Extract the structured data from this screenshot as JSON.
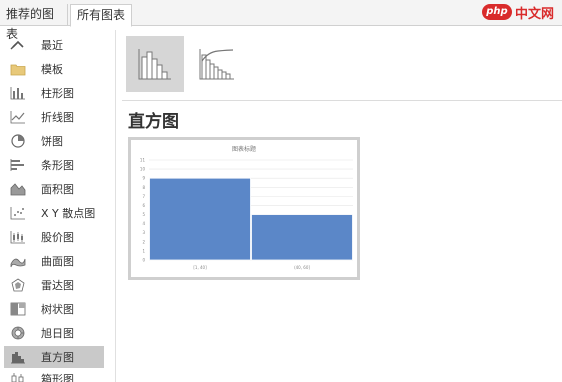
{
  "tabs": [
    {
      "label": "推荐的图表",
      "active": false
    },
    {
      "label": "所有图表",
      "active": true
    }
  ],
  "watermark": {
    "logo": "php",
    "text": "中文网"
  },
  "sidebar": {
    "items": [
      {
        "label": "最近",
        "icon": "recent-icon"
      },
      {
        "label": "模板",
        "icon": "folder-icon"
      },
      {
        "label": "柱形图",
        "icon": "column-chart-icon"
      },
      {
        "label": "折线图",
        "icon": "line-chart-icon"
      },
      {
        "label": "饼图",
        "icon": "pie-chart-icon"
      },
      {
        "label": "条形图",
        "icon": "bar-chart-icon"
      },
      {
        "label": "面积图",
        "icon": "area-chart-icon"
      },
      {
        "label": "X Y 散点图",
        "icon": "scatter-chart-icon"
      },
      {
        "label": "股价图",
        "icon": "stock-chart-icon"
      },
      {
        "label": "曲面图",
        "icon": "surface-chart-icon"
      },
      {
        "label": "雷达图",
        "icon": "radar-chart-icon"
      },
      {
        "label": "树状图",
        "icon": "treemap-chart-icon"
      },
      {
        "label": "旭日图",
        "icon": "sunburst-chart-icon"
      },
      {
        "label": "直方图",
        "icon": "histogram-chart-icon",
        "selected": true
      },
      {
        "label": "箱形图",
        "icon": "box-whisker-chart-icon"
      }
    ]
  },
  "main": {
    "subtypes": [
      {
        "name": "histogram-subtype",
        "selected": true
      },
      {
        "name": "pareto-subtype",
        "selected": false
      }
    ],
    "heading": "直方图"
  },
  "chart_data": {
    "type": "bar",
    "title": "图表标题",
    "categories": [
      "[1, 40]",
      "(40, 60]"
    ],
    "values": [
      9,
      5
    ],
    "ylim": [
      0,
      11
    ],
    "yticks": [
      0,
      1,
      2,
      3,
      4,
      5,
      6,
      7,
      8,
      9,
      10,
      11
    ],
    "grid": true,
    "bar_color": "#5b87c8"
  }
}
